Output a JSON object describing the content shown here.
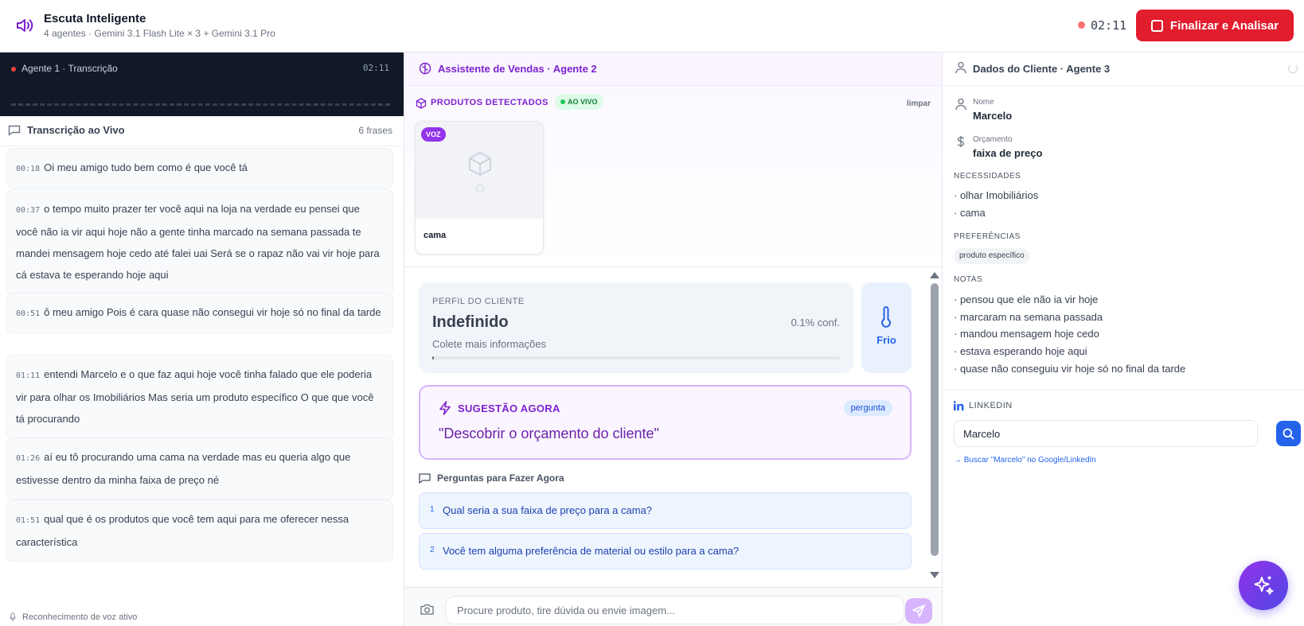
{
  "header": {
    "title": "Escuta Inteligente",
    "subtitle": "4 agentes · Gemini 3.1 Flash Lite × 3 + Gemini 3.1 Pro",
    "timer": "02:11",
    "finish_label": "Finalizar e Analisar"
  },
  "transcription": {
    "agent_label": "Agente 1 · Transcrição",
    "agent_time": "02:11",
    "title": "Transcrição ao Vivo",
    "count": "6 frases",
    "messages": [
      {
        "time": "00:18",
        "text": "Oi meu amigo tudo bem como é que você tá"
      },
      {
        "time": "00:37",
        "text": "o tempo muito prazer ter você aqui na loja na verdade eu pensei que você não ia vir aqui hoje não a gente tinha marcado na semana passada te mandei mensagem hoje cedo até falei uai Será se o rapaz não vai vir hoje para cá estava te esperando hoje aqui"
      },
      {
        "time": "00:51",
        "text": "ô meu amigo Pois é cara quase não consegui vir hoje só no final da tarde"
      },
      {
        "time": "01:11",
        "text": "entendi Marcelo e o que faz aqui hoje você tinha falado que ele poderia vir para olhar os Imobiliários Mas seria um produto específico O que que você tá procurando"
      },
      {
        "time": "01:26",
        "text": "aí eu tô procurando uma cama na verdade mas eu queria algo que estivesse dentro da minha faixa de preço né"
      },
      {
        "time": "01:51",
        "text": "qual que é os produtos que você tem aqui para me oferecer nessa característica"
      }
    ],
    "voice_status": "Reconhecimento de voz ativo"
  },
  "assistant": {
    "title": "Assistente de Vendas · Agente 2",
    "products_label": "PRODUTOS DETECTADOS",
    "live_label": "AO VIVO",
    "clear_label": "limpar",
    "products": [
      {
        "badge": "VOZ",
        "name": "cama"
      }
    ],
    "profile": {
      "label": "PERFIL DO CLIENTE",
      "value": "Indefinido",
      "confidence": "0.1% conf.",
      "confidence_fraction": 0.001,
      "hint": "Colete mais informações"
    },
    "temperature": "Frio",
    "suggestion": {
      "label": "SUGESTÃO AGORA",
      "tag": "pergunta",
      "text": "\"Descobrir o orçamento do cliente\""
    },
    "questions_label": "Perguntas para Fazer Agora",
    "questions": [
      {
        "n": "1",
        "text": "Qual seria a sua faixa de preço para a cama?"
      },
      {
        "n": "2",
        "text": "Você tem alguma preferência de material ou estilo para a cama?"
      }
    ],
    "input_placeholder": "Procure produto, tire dúvida ou envie imagem..."
  },
  "client": {
    "title": "Dados do Cliente · Agente 3",
    "name_label": "Nome",
    "name": "Marcelo",
    "budget_label": "Orçamento",
    "budget": "faixa de preço",
    "needs_label": "NECESSIDADES",
    "needs": [
      "· olhar Imobiliários",
      "· cama"
    ],
    "prefs_label": "PREFERÊNCIAS",
    "prefs": [
      "produto específico"
    ],
    "notes_label": "NOTAS",
    "notes": [
      "· pensou que ele não ia vir hoje",
      "· marcaram na semana passada",
      "· mandou mensagem hoje cedo",
      "· estava esperando hoje aqui",
      "· quase não conseguiu vir hoje só no final da tarde"
    ],
    "linkedin_label": "LINKEDIN",
    "linkedin_value": "Marcelo",
    "linkedin_link": "→ Buscar \"Marcelo\" no Google/LinkedIn"
  },
  "colors": {
    "accent": "#7e22ce",
    "danger": "#e11d2e",
    "blue": "#2563eb"
  }
}
